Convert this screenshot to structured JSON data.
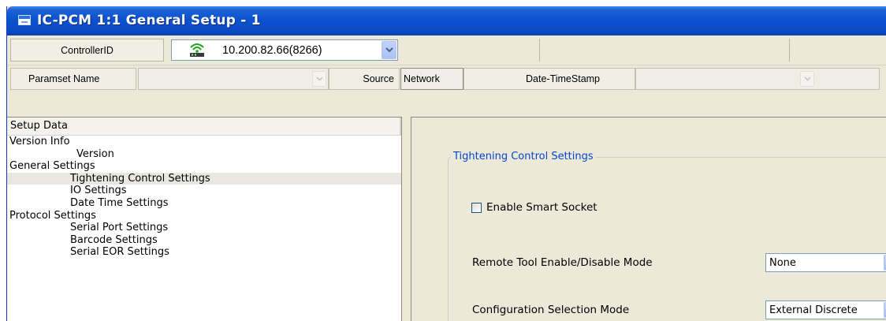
{
  "window": {
    "title": "IC-PCM 1:1 General Setup - 1"
  },
  "controller": {
    "label": "ControllerID",
    "value": "10.200.82.66(8266)",
    "icon": "network-icon"
  },
  "paramset": {
    "name_label": "Paramset Name",
    "name_value": "",
    "source_label": "Source",
    "source_value": "Network",
    "datetime_label": "Date-TimeStamp",
    "datetime_value": ""
  },
  "tree": {
    "header": "Setup Data",
    "items": [
      {
        "label": "Version Info",
        "level": 0
      },
      {
        "label": "Version",
        "level": 1
      },
      {
        "label": "General Settings",
        "level": 0
      },
      {
        "label": "Tightening Control Settings",
        "level": 1,
        "selected": true
      },
      {
        "label": "IO Settings",
        "level": 1
      },
      {
        "label": "Date Time Settings",
        "level": 1
      },
      {
        "label": "Protocol Settings",
        "level": 0
      },
      {
        "label": "Serial Port Settings",
        "level": 1
      },
      {
        "label": "Barcode Settings",
        "level": 1
      },
      {
        "label": "Serial EOR Settings",
        "level": 1
      }
    ]
  },
  "settings": {
    "group_title": "Tightening Control Settings",
    "smart_socket_label": "Enable Smart Socket",
    "smart_socket_checked": false,
    "remote_tool_label": "Remote Tool Enable/Disable Mode",
    "remote_tool_value": "None",
    "config_selection_label": "Configuration Selection Mode",
    "config_selection_value": "External Discrete"
  },
  "colors": {
    "titlebar": "#0b4bc7",
    "group_title": "#0046d5",
    "window_bg": "#ece9d8"
  }
}
